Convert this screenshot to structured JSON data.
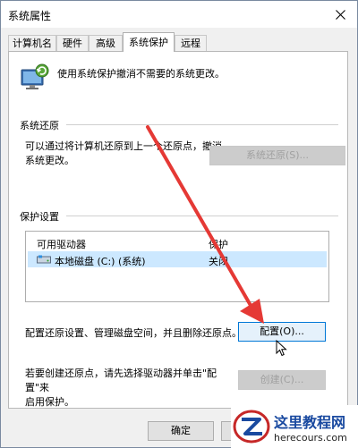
{
  "window": {
    "title": "系统属性"
  },
  "tabs": [
    {
      "label": "计算机名",
      "active": false
    },
    {
      "label": "硬件",
      "active": false
    },
    {
      "label": "高级",
      "active": false
    },
    {
      "label": "系统保护",
      "active": true
    },
    {
      "label": "远程",
      "active": false
    }
  ],
  "intro": {
    "text": "使用系统保护撤消不需要的系统更改。",
    "icon": "system-protection-icon"
  },
  "restore": {
    "section_title": "系统还原",
    "description_line1": "可以通过将计算机还原到上一个还原点，撤消",
    "description_line2": "系统更改。",
    "button_label": "系统还原(S)..."
  },
  "protection": {
    "section_title": "保护设置",
    "columns": [
      "可用驱动器",
      "保护"
    ],
    "drives": [
      {
        "name": "本地磁盘 (C:) (系统)",
        "status": "关闭",
        "icon": "drive-icon"
      }
    ],
    "configure_text": "配置还原设置、管理磁盘空间，并且删除还原点。",
    "configure_button": "配置(O)...",
    "create_text_line1": "若要创建还原点，请先选择驱动器并单击\"配置\"来",
    "create_text_line2": "启用保护。",
    "create_button": "创建(C)..."
  },
  "footer": {
    "ok_label": "确定"
  },
  "watermark": {
    "cn": "这里教程网",
    "en": "herecours.com"
  },
  "colors": {
    "selection": "#cce8ff",
    "arrow": "#e53935",
    "watermark_blue": "#1a4aa0"
  }
}
